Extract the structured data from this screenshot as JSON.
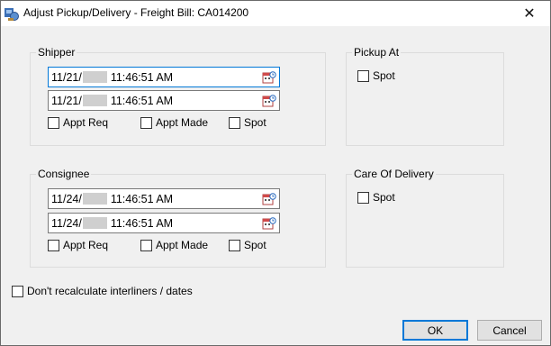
{
  "window": {
    "title": "Adjust Pickup/Delivery - Freight Bill: CA014200",
    "close_glyph": "✕"
  },
  "shipper": {
    "label": "Shipper",
    "date1": {
      "month_day": "11/21/",
      "time": "11:46:51 AM"
    },
    "date2": {
      "month_day": "11/21/",
      "time": "11:46:51 AM"
    },
    "appt_req": "Appt Req",
    "appt_made": "Appt Made",
    "spot": "Spot"
  },
  "consignee": {
    "label": "Consignee",
    "date1": {
      "month_day": "11/24/",
      "time": "11:46:51 AM"
    },
    "date2": {
      "month_day": "11/24/",
      "time": "11:46:51 AM"
    },
    "appt_req": "Appt Req",
    "appt_made": "Appt Made",
    "spot": "Spot"
  },
  "pickup_at": {
    "label": "Pickup At",
    "spot": "Spot"
  },
  "care_of_delivery": {
    "label": "Care Of Delivery",
    "spot": "Spot"
  },
  "dont_recalc": "Don't recalculate interliners / dates",
  "buttons": {
    "ok": "OK",
    "cancel": "Cancel"
  },
  "colors": {
    "accent": "#0078d7",
    "dialog_bg": "#f0f0f0",
    "masked": "#cfcfcf"
  },
  "icons": {
    "app": "app-icon",
    "calendar": "calendar-icon",
    "close": "close-icon"
  }
}
